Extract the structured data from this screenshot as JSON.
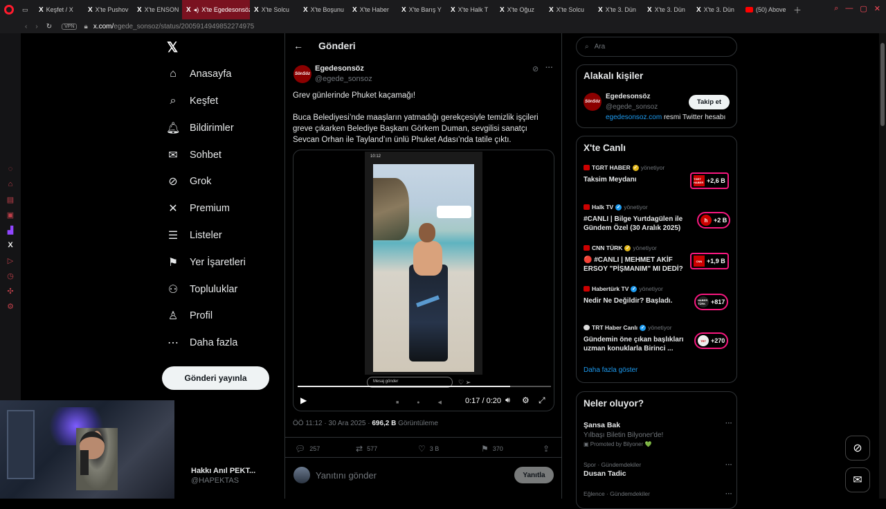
{
  "browser": {
    "tabs": [
      {
        "label": "Keşfet / X",
        "active": false
      },
      {
        "label": "X'te Pushov",
        "active": false
      },
      {
        "label": "X'te ENSON",
        "active": false
      },
      {
        "label": "X'te Egedesonsöz",
        "active": true
      },
      {
        "label": "X'te Solcu",
        "active": false
      },
      {
        "label": "X'te Boşunu",
        "active": false
      },
      {
        "label": "X'te Haber",
        "active": false
      },
      {
        "label": "X'te Barış Y",
        "active": false
      },
      {
        "label": "X'te Halk T",
        "active": false
      },
      {
        "label": "X'te Oğuz",
        "active": false
      },
      {
        "label": "X'te Solcu",
        "active": false
      },
      {
        "label": "X'te 3. Dün",
        "active": false
      },
      {
        "label": "X'te 3. Dün",
        "active": false
      },
      {
        "label": "X'te 3. Dün",
        "active": false
      },
      {
        "label": "(50) Above",
        "active": false
      }
    ],
    "vpn": "VPN",
    "url_domain": "x.com/",
    "url_path": "egede_sonsoz/status/2005914949852274975"
  },
  "nav": {
    "items": [
      {
        "label": "Anasayfa",
        "icon": "home-icon",
        "glyph": "⌂"
      },
      {
        "label": "Keşfet",
        "icon": "search-icon",
        "glyph": "⌕"
      },
      {
        "label": "Bildirimler",
        "icon": "bell-icon",
        "glyph": "♫"
      },
      {
        "label": "Sohbet",
        "icon": "mail-icon",
        "glyph": "✉"
      },
      {
        "label": "Grok",
        "icon": "grok-icon",
        "glyph": "⊘"
      },
      {
        "label": "Premium",
        "icon": "x-premium-icon",
        "glyph": "✕"
      },
      {
        "label": "Listeler",
        "icon": "list-icon",
        "glyph": "☰"
      },
      {
        "label": "Yer İşaretleri",
        "icon": "bookmark-icon",
        "glyph": "⚑"
      },
      {
        "label": "Topluluklar",
        "icon": "communities-icon",
        "glyph": "⚇"
      },
      {
        "label": "Profil",
        "icon": "profile-icon",
        "glyph": "♙"
      },
      {
        "label": "Daha fazla",
        "icon": "more-circle-icon",
        "glyph": "⋯"
      }
    ],
    "post_button": "Gönderi yayınla",
    "account_name": "Hakkı Anıl PEKT...",
    "account_handle": "@HAPEKTAS"
  },
  "main": {
    "title": "Gönderi",
    "author_name": "Egedesonsöz",
    "author_handle": "@egede_sonsoz",
    "avatar_text": "SönSöz",
    "paragraph1": "Grev günlerinde Phuket kaçamağı!",
    "paragraph2": "Buca Belediyesi’nde maaşların yatmadığı gerekçesiyle temizlik işçileri greve çıkarken Belediye Başkanı Görkem Duman, sevgilisi sanatçı Sevcan Orhan ile Tayland’ın ünlü Phuket Adası’nda tatile çıktı.",
    "video": {
      "status_time": "10:12",
      "message_placeholder": "Mesaj gönder",
      "time": "0:17 / 0:20",
      "progress": 0.84
    },
    "timestamp": "ÖÖ 11:12 · 30 Ara 2025 · ",
    "views_count": "696,2 B",
    "views_label": "Görüntüleme",
    "replies": "257",
    "reposts": "577",
    "likes": "3 B",
    "bookmarks": "370",
    "reply_placeholder": "Yanıtını gönder",
    "reply_button": "Yanıtla"
  },
  "right": {
    "search_placeholder": "Ara",
    "relevant_title": "Alakalı kişiler",
    "person_name": "Egedesonsöz",
    "person_handle": "@egede_sonsoz",
    "person_link": "egedesonsoz.com",
    "person_bio_rest": " resmi Twitter hesabı",
    "follow": "Takip et",
    "live_title": "X'te Canlı",
    "live": [
      {
        "source": "TGRT HABER",
        "managing": "yönetiyor",
        "title": "Taksim Meydanı",
        "count": "+2,6 B",
        "logo": "TGRT HABER"
      },
      {
        "source": "Halk TV",
        "managing": "yönetiyor",
        "title": "#CANLI | Bilge Yurtdagülen ile Gündem Özel (30 Aralık 2025)",
        "count": "+2 B",
        "logo": "h"
      },
      {
        "source": "CNN TÜRK",
        "managing": "yönetiyor",
        "title": "🔴 #CANLI | MEHMET AKİF ERSOY \"PİŞMANIM\" MI DEDİ?",
        "count": "+1,9 B",
        "logo": "CNN"
      },
      {
        "source": "Habertürk TV",
        "managing": "yönetiyor",
        "title": "Nedir Ne Değildir? Başladı.",
        "count": "+817",
        "logo": "HABER TÜRK"
      },
      {
        "source": "TRT Haber Canlı",
        "managing": "yönetiyor",
        "title": "Gündemin öne çıkan başlıkları uzman konuklarla Birinci ...",
        "count": "+270",
        "logo": "TRT"
      }
    ],
    "show_more": "Daha fazla göster",
    "happening_title": "Neler oluyor?",
    "trends": [
      {
        "category": "",
        "title": "Şansa Bak",
        "subtitle": "Yılbaşı Biletin Bilyoner'de!",
        "promo": "Promoted by Bilyoner 💚"
      },
      {
        "category": "Spor · Gündemdekiler",
        "title": "Dusan Tadic",
        "subtitle": "",
        "promo": ""
      },
      {
        "category": "Eğlence · Gündemdekiler",
        "title": "",
        "subtitle": "",
        "promo": ""
      }
    ]
  }
}
